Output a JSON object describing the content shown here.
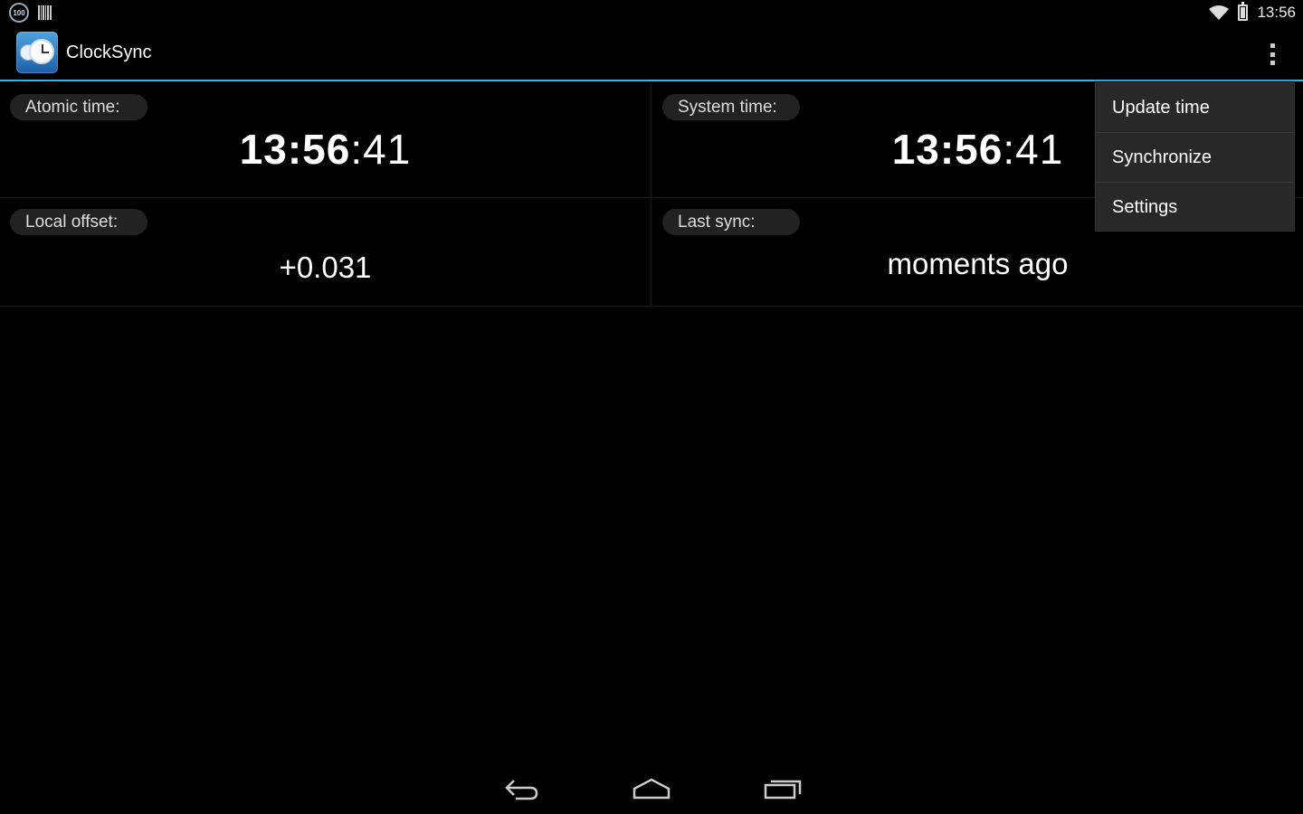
{
  "status_bar": {
    "battery_badge": "100",
    "clock": "13:56"
  },
  "action_bar": {
    "title": "ClockSync"
  },
  "panels": {
    "atomic": {
      "label": "Atomic time:",
      "hours_minutes": "13:56",
      "seconds": ":41"
    },
    "system": {
      "label": "System time:",
      "hours_minutes": "13:56",
      "seconds": ":41"
    },
    "offset": {
      "label": "Local offset:",
      "value": "+0.031"
    },
    "last_sync": {
      "label": "Last sync:",
      "value": "moments ago"
    }
  },
  "menu": {
    "items": [
      {
        "label": "Update time"
      },
      {
        "label": "Synchronize"
      },
      {
        "label": "Settings"
      }
    ]
  },
  "colors": {
    "accent": "#33b5e5",
    "background": "#000000",
    "menu_bg": "#282828"
  }
}
